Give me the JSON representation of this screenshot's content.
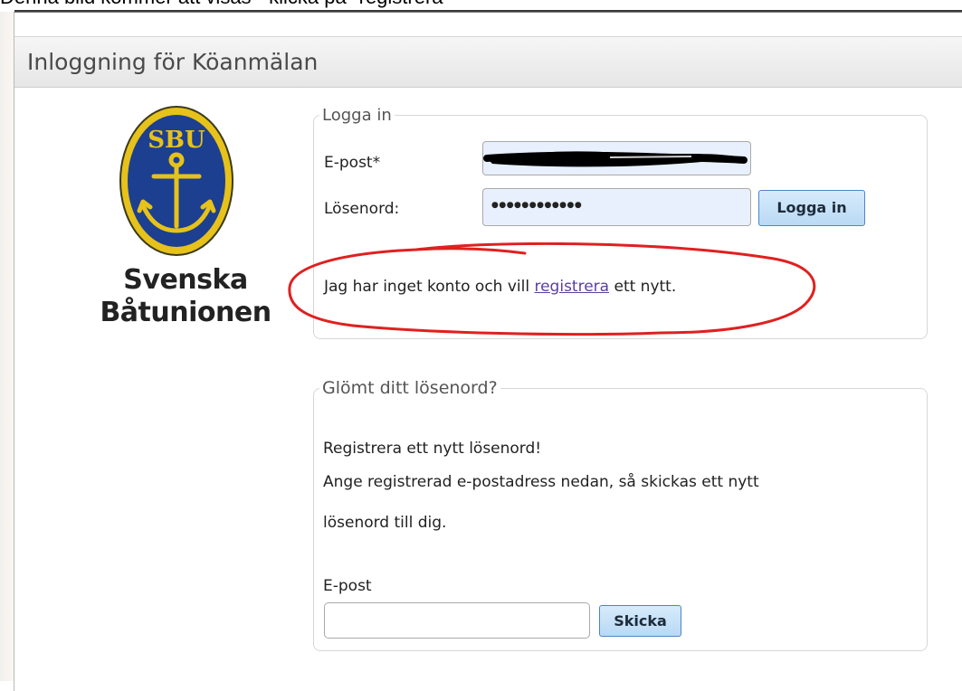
{
  "caption": "Denna bild kommer att visas - klicka på \"registrera\"",
  "header": {
    "title": "Inloggning för Köanmälan"
  },
  "brand": {
    "line1": "Svenska",
    "line2": "Båtunionen",
    "logo_text": "SBU",
    "logo_icon": "anchor-icon"
  },
  "login": {
    "legend": "Logga in",
    "email_label": "E-post*",
    "email_value": "",
    "password_label": "Lösenord:",
    "password_value": "●●●●●●●●●●●●",
    "submit_label": "Logga in",
    "register_prefix": "Jag har inget konto och vill",
    "register_link": "registrera",
    "register_suffix": "ett nytt."
  },
  "forgot": {
    "legend": "Glömt ditt lösenord?",
    "line1": "Registrera ett nytt lösenord!",
    "line2": "Ange registrerad e-postadress nedan, så skickas ett nytt",
    "line3": "lösenord till dig.",
    "email_label": "E-post",
    "email_value": "",
    "submit_label": "Skicka"
  },
  "colors": {
    "annotation": "#e02020",
    "logo_blue": "#1d3f8f",
    "logo_gold": "#e6c21a",
    "link": "#5b3fa0"
  }
}
